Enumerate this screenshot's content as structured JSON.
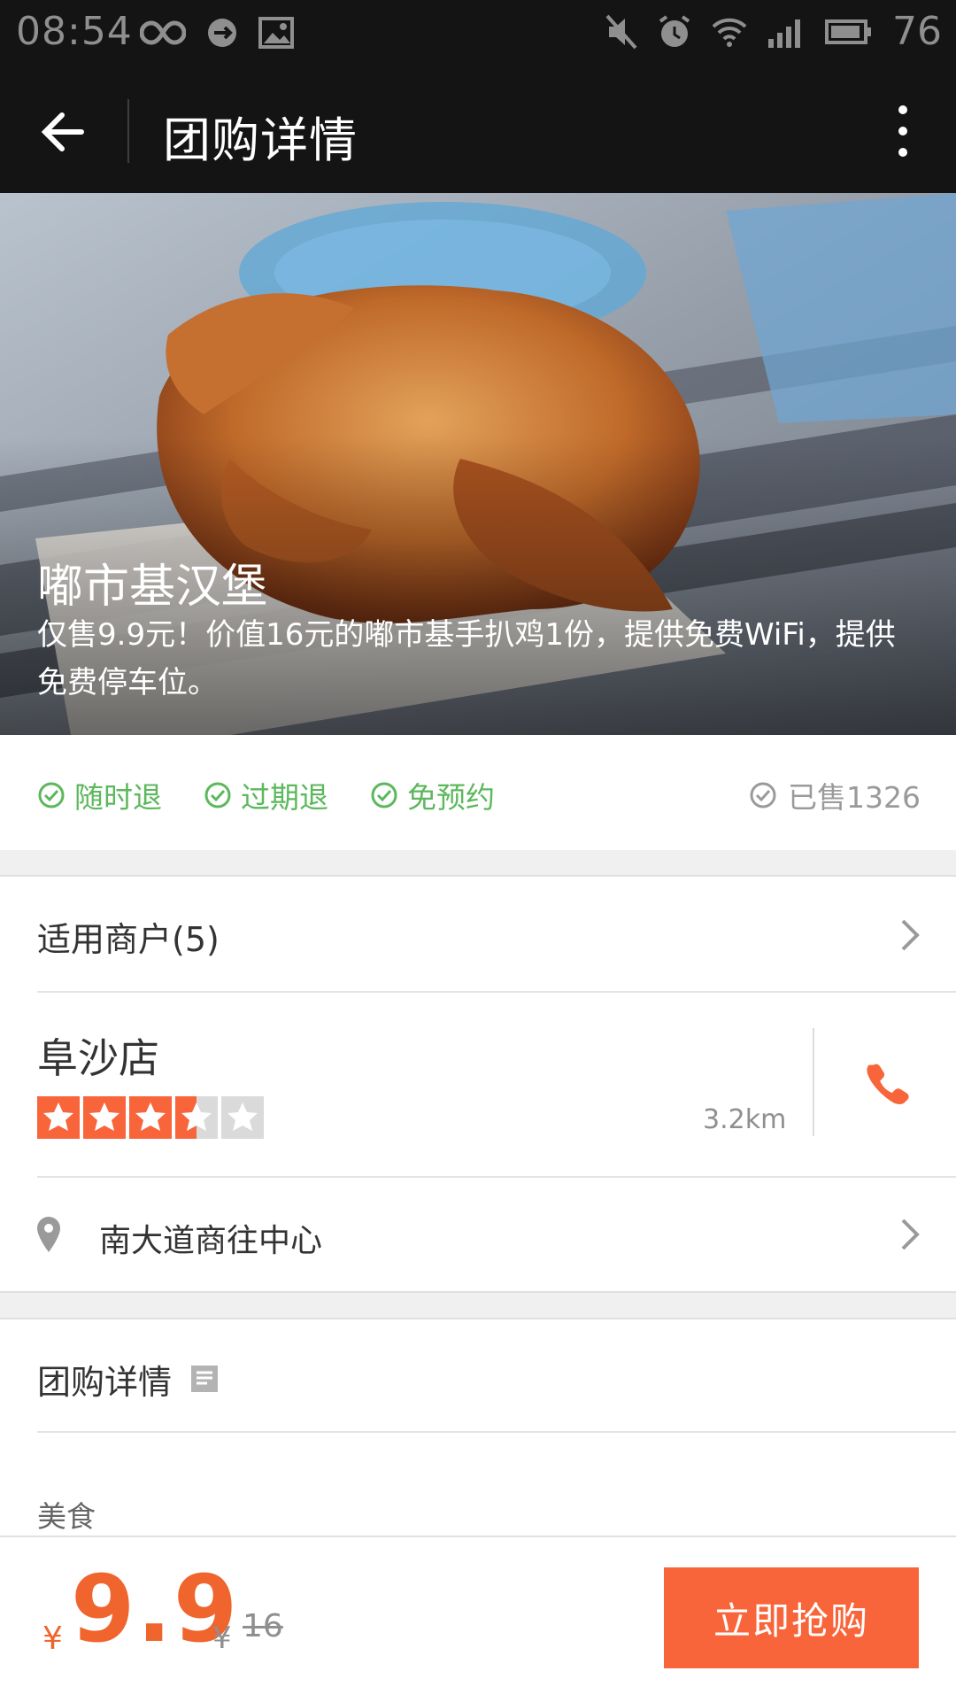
{
  "status_bar": {
    "time": "08:54",
    "battery": "76"
  },
  "app_bar": {
    "title": "团购详情"
  },
  "hero": {
    "title": "嘟市基汉堡",
    "subtitle": "仅售9.9元！价值16元的嘟市基手扒鸡1份，提供免费WiFi，提供免费停车位。",
    "image": "roast-chicken-photo"
  },
  "tags": [
    "随时退",
    "过期退",
    "免预约"
  ],
  "sold": "已售1326",
  "merchants": {
    "label": "适用商户(5)"
  },
  "store": {
    "name": "阜沙店",
    "rating": 3.5,
    "rating_max": 5,
    "distance": "3.2km"
  },
  "address": "南大道商往中心",
  "detail": {
    "label": "团购详情"
  },
  "category": "美食",
  "bottom": {
    "currency": "¥",
    "price": "9.9",
    "orig_currency": "¥",
    "orig_price": "16",
    "buy_label": "立即抢购"
  },
  "colors": {
    "accent": "#f9653a",
    "price": "#f0642d",
    "tag_green": "#5cb85c",
    "star": "#f9653a"
  }
}
